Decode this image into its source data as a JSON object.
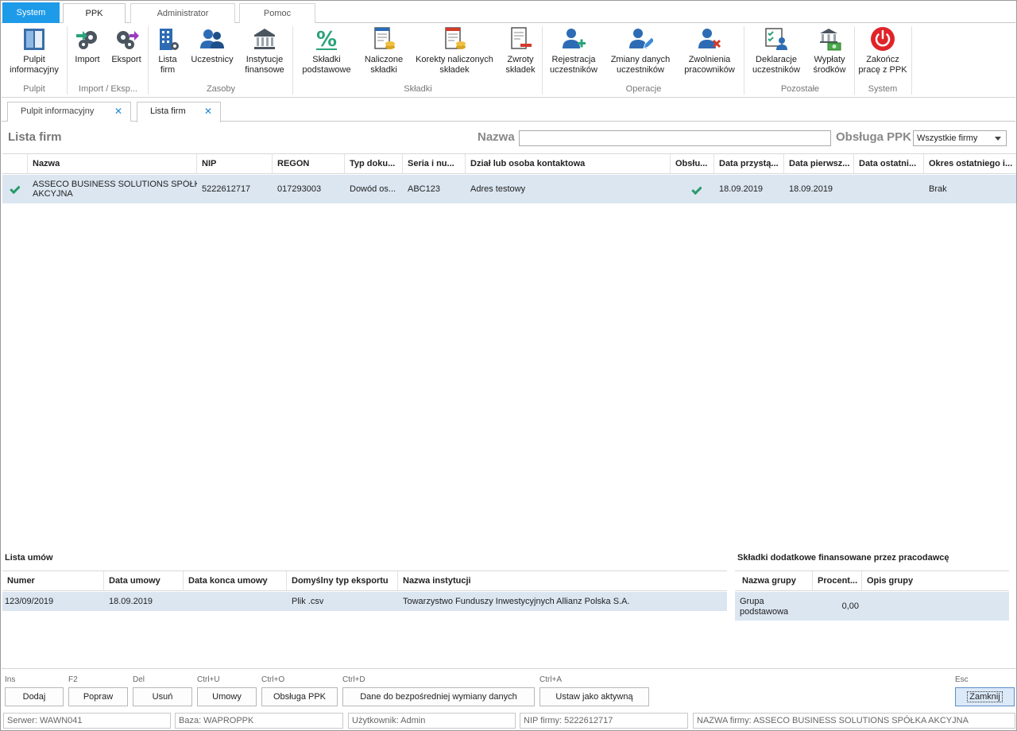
{
  "menu_tabs": [
    "System",
    "PPK",
    "Administrator",
    "Pomoc"
  ],
  "ribbon": {
    "buttons": [
      {
        "label1": "Pulpit",
        "label2": "informacyjny",
        "icon": "dashboard-icon"
      },
      {
        "label1": "Import",
        "label2": "",
        "icon": "import-gears-icon"
      },
      {
        "label1": "Eksport",
        "label2": "",
        "icon": "export-gears-icon"
      },
      {
        "label1": "Lista",
        "label2": "firm",
        "icon": "company-building-icon"
      },
      {
        "label1": "Uczestnicy",
        "label2": "",
        "icon": "users-icon"
      },
      {
        "label1": "Instytucje",
        "label2": "finansowe",
        "icon": "bank-icon"
      },
      {
        "label1": "Składki",
        "label2": "podstawowe",
        "icon": "percent-icon"
      },
      {
        "label1": "Naliczone",
        "label2": "składki",
        "icon": "calculated-contributions-icon"
      },
      {
        "label1": "Korekty naliczonych",
        "label2": "składek",
        "icon": "contribution-corrections-icon"
      },
      {
        "label1": "Zwroty",
        "label2": "składek",
        "icon": "contribution-returns-icon"
      },
      {
        "label1": "Rejestracja",
        "label2": "uczestników",
        "icon": "user-add-icon"
      },
      {
        "label1": "Zmiany danych",
        "label2": "uczestników",
        "icon": "user-edit-icon"
      },
      {
        "label1": "Zwolnienia",
        "label2": "pracowników",
        "icon": "user-remove-icon"
      },
      {
        "label1": "Deklaracje",
        "label2": "uczestników",
        "icon": "declarations-icon"
      },
      {
        "label1": "Wypłaty",
        "label2": "środków",
        "icon": "payouts-icon"
      },
      {
        "label1": "Zakończ",
        "label2": "pracę z PPK",
        "icon": "power-icon"
      }
    ],
    "groups": [
      "Pulpit",
      "Import / Eksp...",
      "Zasoby",
      "Składki",
      "Operacje",
      "Pozostałe",
      "System"
    ]
  },
  "doc_tabs": [
    "Pulpit informacyjny",
    "Lista firm"
  ],
  "doc_tab_close": "✕",
  "page": {
    "title": "Lista firm",
    "filter_name_label": "Nazwa",
    "filter_name_value": "",
    "filter_ppk_label": "Obsługa PPK",
    "filter_ppk_value": "Wszystkie firmy"
  },
  "firms_table": {
    "headers": [
      "",
      "Nazwa",
      "NIP",
      "REGON",
      "Typ doku...",
      "Seria i nu...",
      "Dział lub osoba kontaktowa",
      "Obsłu...",
      "Data przystą...",
      "Data pierwsz...",
      "Data ostatni...",
      "Okres ostatniego i..."
    ],
    "rows": [
      {
        "active": true,
        "name_line1": "ASSECO BUSINESS SOLUTIONS SPÓŁKA",
        "name_line2": "AKCYJNA",
        "nip": "5222612717",
        "regon": "017293003",
        "doc_type": "Dowód os...",
        "series": "ABC123",
        "contact": "Adres testowy",
        "ppk": true,
        "date_join": "18.09.2019",
        "date_first": "18.09.2019",
        "date_last": "",
        "last_period": "Brak"
      }
    ]
  },
  "contracts": {
    "label": "Lista umów",
    "headers": [
      "Numer",
      "Data umowy",
      "Data konca umowy",
      "Domyślny typ eksportu",
      "Nazwa instytucji"
    ],
    "rows": [
      {
        "number": "123/09/2019",
        "date": "18.09.2019",
        "end_date": "",
        "export_type": "Plik .csv",
        "institution": "Towarzystwo Funduszy Inwestycyjnych Allianz Polska S.A."
      }
    ]
  },
  "extra_contrib": {
    "label": "Składki dodatkowe finansowane przez pracodawcę",
    "headers": [
      "Nazwa grupy",
      "Procent...",
      "Opis grupy"
    ],
    "rows": [
      {
        "group_line1": "Grupa",
        "group_line2": "podstawowa",
        "percent": "0,00",
        "desc": ""
      }
    ]
  },
  "actions": [
    {
      "hotkey": "Ins",
      "label": "Dodaj"
    },
    {
      "hotkey": "F2",
      "label": "Popraw"
    },
    {
      "hotkey": "Del",
      "label": "Usuń"
    },
    {
      "hotkey": "Ctrl+U",
      "label": "Umowy"
    },
    {
      "hotkey": "Ctrl+O",
      "label": "Obsługa PPK"
    },
    {
      "hotkey": "Ctrl+D",
      "label": "Dane do bezpośredniej wymiany danych"
    },
    {
      "hotkey": "Ctrl+A",
      "label": "Ustaw jako aktywną"
    },
    {
      "hotkey": "Esc",
      "label": "Zamknij"
    }
  ],
  "status": {
    "server": "Serwer: WAWN041",
    "db": "Baza: WAPROPPK",
    "user": "Użytkownik: Admin",
    "nip": "NIP firmy: 5222612717",
    "firm": "NAZWA firmy: ASSECO BUSINESS SOLUTIONS SPÓŁKA AKCYJNA"
  },
  "colors": {
    "accent": "#1e9be8",
    "row_selected": "#dbe6f1",
    "check_green": "#2a9a6a",
    "power_red": "#e0242a"
  }
}
